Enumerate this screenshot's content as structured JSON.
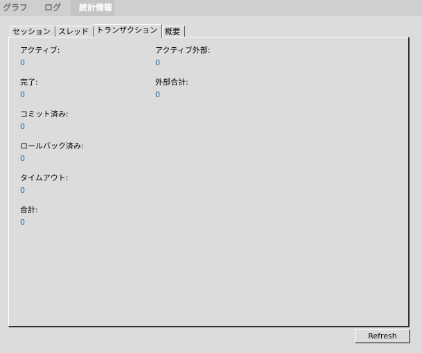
{
  "top_tabs": [
    "グラフ",
    "ログ",
    "統計情報"
  ],
  "sub_tabs": [
    "セッション",
    "スレッド",
    "トランザクション",
    "概要"
  ],
  "stats": {
    "active": {
      "label": "アクティブ:",
      "value": "0"
    },
    "completed": {
      "label": "完了:",
      "value": "0"
    },
    "committed": {
      "label": "コミット済み:",
      "value": "0"
    },
    "rolledback": {
      "label": "ロールバック済み:",
      "value": "0"
    },
    "timeout": {
      "label": "タイムアウト:",
      "value": "0"
    },
    "total": {
      "label": "合計:",
      "value": "0"
    },
    "active_external": {
      "label": "アクティブ外部:",
      "value": "0"
    },
    "external_total": {
      "label": "外部合計:",
      "value": "0"
    }
  },
  "refresh_label": "Refresh",
  "colors": {
    "background": "#dcdcdc",
    "value_text": "#1f6d9c",
    "active_top_tab_text": "#ffffff"
  }
}
